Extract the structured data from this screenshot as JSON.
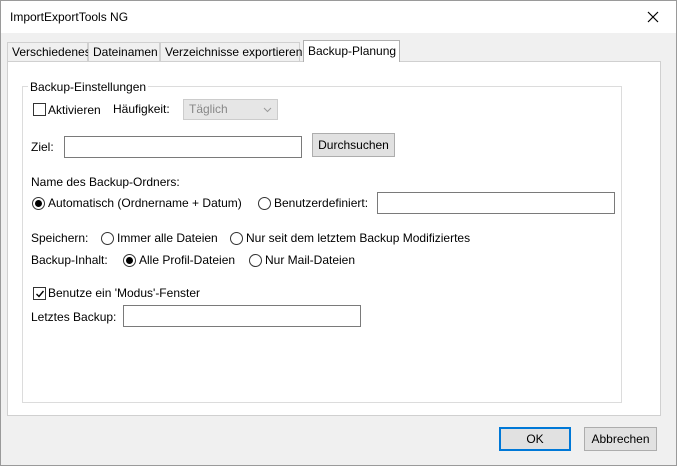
{
  "window": {
    "title": "ImportExportTools NG"
  },
  "tabs": [
    {
      "label": "Verschiedenes"
    },
    {
      "label": "Dateinamen"
    },
    {
      "label": "Verzeichnisse exportieren"
    },
    {
      "label": "Backup-Planung",
      "active": true
    }
  ],
  "group": {
    "label": "Backup-Einstellungen",
    "activate": {
      "label": "Aktivieren",
      "checked": false
    },
    "frequency": {
      "label": "Häufigkeit:",
      "value": "Täglich",
      "disabled": true
    },
    "target": {
      "label": "Ziel:",
      "value": "",
      "browse_label": "Durchsuchen"
    },
    "folder_name": {
      "label": "Name des Backup-Ordners:",
      "auto_label": "Automatisch (Ordnername + Datum)",
      "custom_label": "Benutzerdefiniert:",
      "custom_value": "",
      "selected": "auto"
    },
    "save": {
      "label": "Speichern:",
      "all_label": "Immer alle Dateien",
      "modified_label": "Nur seit dem letztem Backup Modifiziertes",
      "selected": "none"
    },
    "content": {
      "label": "Backup-Inhalt:",
      "all_label": "Alle Profil-Dateien",
      "mail_label": "Nur Mail-Dateien",
      "selected": "all"
    },
    "modal": {
      "label": "Benutze ein 'Modus'-Fenster",
      "checked": true
    },
    "last_backup": {
      "label": "Letztes Backup:",
      "value": ""
    }
  },
  "footer": {
    "ok_label": "OK",
    "cancel_label": "Abbrechen"
  },
  "icons": {
    "close": "close-icon",
    "chevron": "chevron-down-icon",
    "check": "checkmark-icon"
  },
  "colors": {
    "accent": "#0078d7",
    "window_bg": "#f0f0f0",
    "panel_bg": "#ffffff"
  }
}
